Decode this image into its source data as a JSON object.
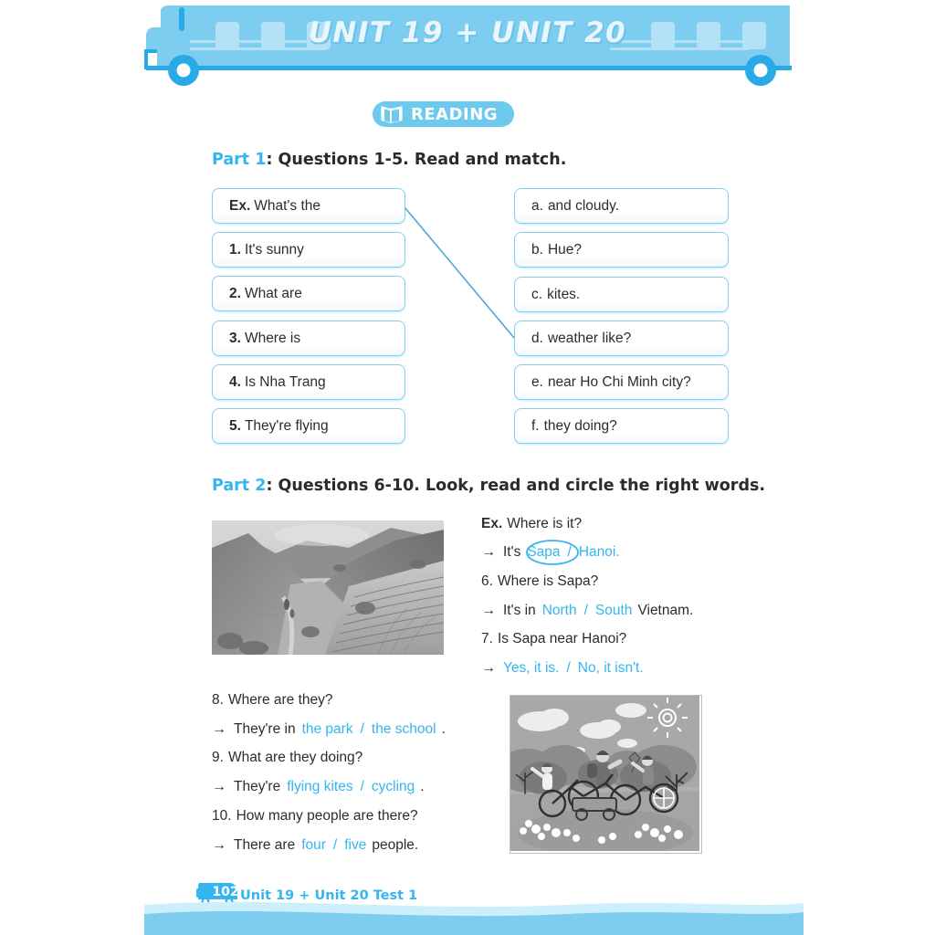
{
  "header": {
    "title": "UNIT 19 + UNIT 20",
    "bus_color": "#7dcdf0",
    "bus_accent": "#29a9e6",
    "title_color": "#eaf6fd"
  },
  "badge": {
    "label": "READING",
    "icon": "open-book-icon",
    "color": "#6ec9ee"
  },
  "part1": {
    "part_label": "Part 1",
    "heading_rest": ": Questions 1-5. Read and match.",
    "left_items": [
      {
        "marker": "Ex.",
        "text": "What's the"
      },
      {
        "marker": "1.",
        "text": "It's sunny"
      },
      {
        "marker": "2.",
        "text": "What are"
      },
      {
        "marker": "3.",
        "text": "Where is"
      },
      {
        "marker": "4.",
        "text": "Is Nha Trang"
      },
      {
        "marker": "5.",
        "text": "They're flying"
      }
    ],
    "right_items": [
      {
        "marker": "a.",
        "text": "and cloudy."
      },
      {
        "marker": "b.",
        "text": "Hue?"
      },
      {
        "marker": "c.",
        "text": "kites."
      },
      {
        "marker": "d.",
        "text": "weather like?"
      },
      {
        "marker": "e.",
        "text": "near Ho Chi Minh city?"
      },
      {
        "marker": "f.",
        "text": "they doing?"
      }
    ],
    "match_line": {
      "from": "Ex. What's the",
      "to": "d. weather like?",
      "color": "#4ba9d4"
    }
  },
  "part2": {
    "part_label": "Part 2",
    "heading_rest": ": Questions 6-10. Look, read and circle the right words.",
    "photo_landscape": "terraced-rice-fields-photo",
    "photo_illustration": "children-cycling-park-illustration",
    "items": [
      {
        "number": "Ex.",
        "question": "Where is it?",
        "answer_prefix": "It's",
        "option_a": "Sapa",
        "separator": "/",
        "option_b": "Hanoi.",
        "answer_suffix": "",
        "circled": "Sapa"
      },
      {
        "number": "6.",
        "question": "Where is Sapa?",
        "answer_prefix": "It's in",
        "option_a": "North",
        "separator": "/",
        "option_b": "South",
        "answer_suffix": "Vietnam.",
        "circled": ""
      },
      {
        "number": "7.",
        "question": "Is Sapa near Hanoi?",
        "answer_prefix": "",
        "option_a": "Yes, it is.",
        "separator": "/",
        "option_b": "No, it isn't.",
        "answer_suffix": "",
        "circled": ""
      },
      {
        "number": "8.",
        "question": "Where are they?",
        "answer_prefix": "They're in",
        "option_a": "the park",
        "separator": "/",
        "option_b": "the school",
        "answer_suffix": ".",
        "circled": ""
      },
      {
        "number": "9.",
        "question": "What are they doing?",
        "answer_prefix": "They're",
        "option_a": "flying kites",
        "separator": "/",
        "option_b": "cycling",
        "answer_suffix": ".",
        "circled": ""
      },
      {
        "number": "10.",
        "question": "How many people are there?",
        "answer_prefix": "There are",
        "option_a": "four",
        "separator": "/",
        "option_b": "five",
        "answer_suffix": "people.",
        "circled": ""
      }
    ]
  },
  "footer": {
    "page_number": "102",
    "label": "Unit 19 + Unit 20 Test 1",
    "icon": "bus-icon",
    "color": "#35b5ef"
  }
}
